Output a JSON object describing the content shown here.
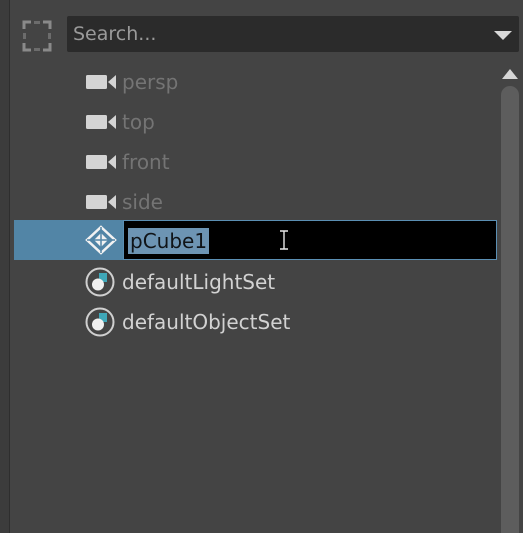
{
  "search": {
    "placeholder": "Search..."
  },
  "outliner": {
    "items": [
      {
        "label": "persp",
        "icon": "camera-icon",
        "state": "dim"
      },
      {
        "label": "top",
        "icon": "camera-icon",
        "state": "dim"
      },
      {
        "label": "front",
        "icon": "camera-icon",
        "state": "dim"
      },
      {
        "label": "side",
        "icon": "camera-icon",
        "state": "dim"
      },
      {
        "label": "pCube1",
        "icon": "mesh-transform-icon",
        "state": "selected-renaming"
      },
      {
        "label": "defaultLightSet",
        "icon": "object-set-icon",
        "state": "normal"
      },
      {
        "label": "defaultObjectSet",
        "icon": "object-set-icon",
        "state": "normal"
      }
    ]
  },
  "colors": {
    "panel_background": "#444444",
    "selection": "#5285a6",
    "rename_field": "#000000",
    "text_highlight": "#6d94b3",
    "dim_text": "#747474",
    "normal_text": "#d2d2d2"
  }
}
